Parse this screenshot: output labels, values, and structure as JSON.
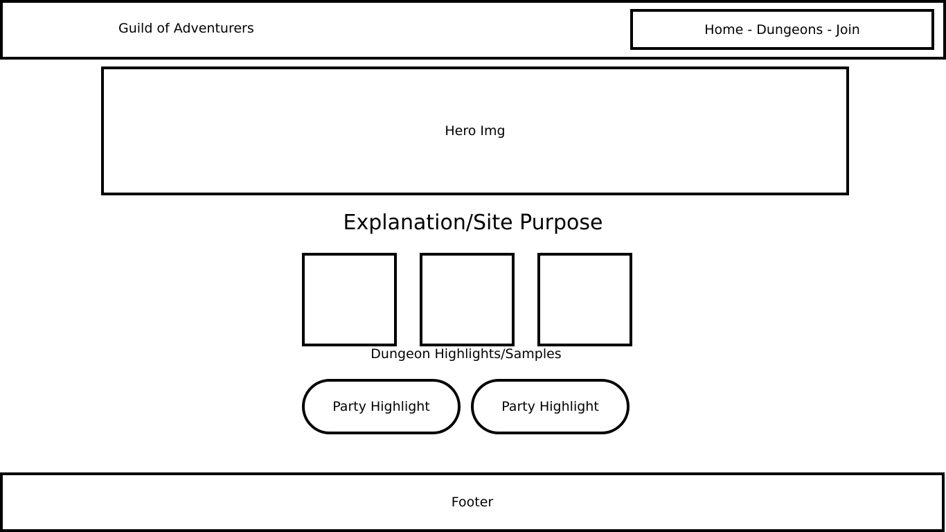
{
  "header": {
    "site_title": "Guild of Adventurers",
    "nav_label": "Home - Dungeons - Join"
  },
  "hero": {
    "label": "Hero Img"
  },
  "explanation": {
    "heading": "Explanation/Site Purpose"
  },
  "dungeons": {
    "caption": "Dungeon Highlights/Samples",
    "count": 3
  },
  "parties": {
    "items": [
      {
        "label": "Party Highlight"
      },
      {
        "label": "Party Highlight"
      }
    ]
  },
  "footer": {
    "label": "Footer"
  },
  "colors": {
    "stroke": "#000000",
    "background": "#ffffff"
  }
}
